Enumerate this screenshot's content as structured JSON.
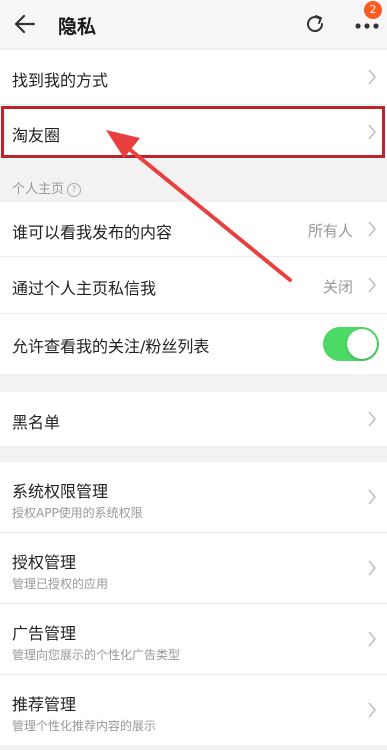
{
  "header": {
    "title": "隐私",
    "badge_count": "2"
  },
  "rows": {
    "find_me": {
      "label": "找到我的方式"
    },
    "taoyouquan": {
      "label": "淘友圈"
    },
    "section_personal": "个人主页",
    "who_can_see": {
      "label": "谁可以看我发布的内容",
      "value": "所有人"
    },
    "private_message": {
      "label": "通过个人主页私信我",
      "value": "关闭"
    },
    "allow_follow_list": {
      "label": "允许查看我的关注/粉丝列表",
      "toggle_on": true
    },
    "blacklist": {
      "label": "黑名单"
    },
    "system_permission": {
      "label": "系统权限管理",
      "sub": "授权APP使用的系统权限"
    },
    "auth_manage": {
      "label": "授权管理",
      "sub": "管理已授权的应用"
    },
    "ad_manage": {
      "label": "广告管理",
      "sub": "管理向您展示的个性化广告类型"
    },
    "recommend_manage": {
      "label": "推荐管理",
      "sub": "管理个性化推荐内容的展示"
    }
  },
  "colors": {
    "highlight": "#c4202a",
    "toggle_on": "#4cd964",
    "badge": "#ff5a1f"
  }
}
